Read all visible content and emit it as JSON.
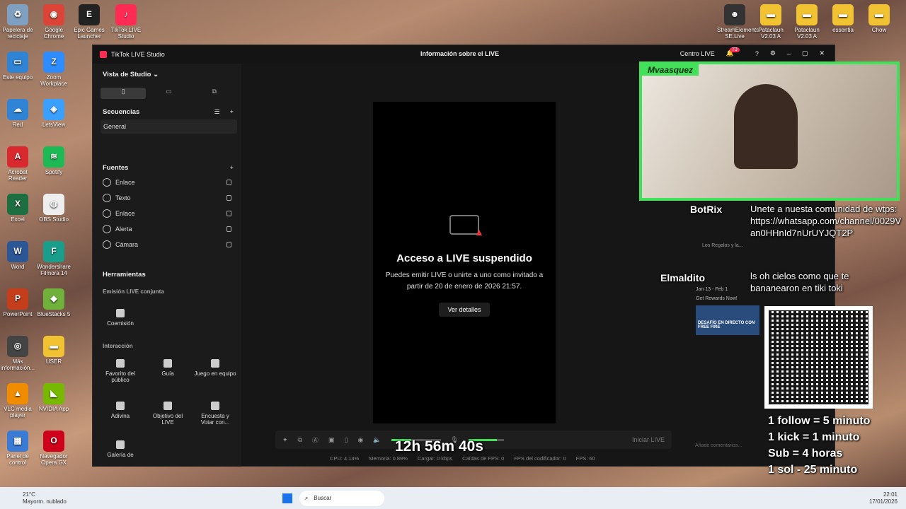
{
  "desktop": {
    "icons": [
      {
        "label": "Papelera de reciclaje",
        "color": "#7fa0c0",
        "glyph": "♻"
      },
      {
        "label": "Este equipo",
        "color": "#2f84d6",
        "glyph": "▭"
      },
      {
        "label": "Red",
        "color": "#2f84d6",
        "glyph": "☁"
      },
      {
        "label": "Acrobat Reader",
        "color": "#d8292f",
        "glyph": "A"
      },
      {
        "label": "Excel",
        "color": "#1d6f42",
        "glyph": "X"
      },
      {
        "label": "Word",
        "color": "#2b5797",
        "glyph": "W"
      },
      {
        "label": "PowerPoint",
        "color": "#c43e1c",
        "glyph": "P"
      },
      {
        "label": "Más información...",
        "color": "#444",
        "glyph": "◎"
      },
      {
        "label": "VLC media player",
        "color": "#f08c00",
        "glyph": "▲"
      },
      {
        "label": "Panel de control",
        "color": "#3a7bd5",
        "glyph": "▦"
      }
    ],
    "icons2": [
      {
        "label": "Google Chrome",
        "color": "#db4437",
        "glyph": "◉"
      },
      {
        "label": "Zoom Workplace",
        "color": "#2d8cff",
        "glyph": "Z"
      },
      {
        "label": "LetsView",
        "color": "#3aa0ff",
        "glyph": "◈"
      },
      {
        "label": "Spotify",
        "color": "#1db954",
        "glyph": "≋"
      },
      {
        "label": "OBS Studio",
        "color": "#eee",
        "glyph": "◍"
      },
      {
        "label": "Wondershare Filmora 14",
        "color": "#1a9e8c",
        "glyph": "F"
      },
      {
        "label": "BlueStacks 5",
        "color": "#6fb13a",
        "glyph": "◆"
      },
      {
        "label": "USER",
        "color": "#f1c232",
        "glyph": "▬"
      },
      {
        "label": "NVIDIA App",
        "color": "#76b900",
        "glyph": "◣"
      },
      {
        "label": "Navegador Opera GX",
        "color": "#d0021b",
        "glyph": "O"
      }
    ],
    "top_icons": [
      {
        "label": "Epic Games Launcher",
        "color": "#222",
        "glyph": "E"
      },
      {
        "label": "TikTok LIVE Studio",
        "color": "#fe2c55",
        "glyph": "♪"
      }
    ],
    "right_icons": [
      {
        "label": "StreamElements SE.Live",
        "color": "#333",
        "glyph": "☻"
      },
      {
        "label": "Pataclaun V2.03 A",
        "color": "#f1c232",
        "glyph": "▬"
      },
      {
        "label": "Pataclaun V2.03 A",
        "color": "#f1c232",
        "glyph": "▬"
      },
      {
        "label": "essentia",
        "color": "#f1c232",
        "glyph": "▬"
      },
      {
        "label": "Chow",
        "color": "#f1c232",
        "glyph": "▬"
      }
    ]
  },
  "window": {
    "title": "TikTok LIVE Studio",
    "center_title": "Información sobre el LIVE",
    "centro_live": "Centro LIVE",
    "notif_count": "73"
  },
  "sidebar": {
    "view_label": "Vista de Studio",
    "sequences_title": "Secuencias",
    "sequence_item": "General",
    "sources_title": "Fuentes",
    "sources": [
      "Enlace",
      "Texto",
      "Enlace",
      "Alerta",
      "Cámara"
    ],
    "tools_title": "Herramientas",
    "joint_title": "Emisión LIVE conjunta",
    "coemision": "Coemisión",
    "interaction_title": "Interacción",
    "tiles": [
      "Favorito del público",
      "Guía",
      "Juego en equipo",
      "Adivina",
      "Objetivo del LIVE",
      "Encuesta y Votar con...",
      "Galería de"
    ]
  },
  "stage": {
    "heading": "Acceso a LIVE suspendido",
    "body1": "Puedes emitir LIVE o unirte a uno como invitado a",
    "body2": "partir de 20 de enero de 2026 21:57.",
    "details_button": "Ver detalles"
  },
  "toolbar": {
    "start_live": "Iniciar LIVE",
    "timer": "12h 56m 40s"
  },
  "status": [
    "CPU: 4.14%",
    "Memoria: 0.89%",
    "Cargar: 0 kbps",
    "Caídas de FPS: 0",
    "FPS del codificador: 0",
    "FPS: 60"
  ],
  "overlay": {
    "cam_name": "Mvaasquez",
    "user1": "BotRix",
    "user1_msg": "Unete a nuesta comunidad de wtps: https://whatsapp.com/channel/0029Van0HHnId7nUrUYJQT2P",
    "user2": "Elmaldito",
    "user2_msg": "ls oh cielos como que te bananearon en tiki toki",
    "rules": [
      "1 follow = 5 minuto",
      "1 kick = 1 minuto",
      "Sub = 4 horas",
      "1 sol - 25 minuto"
    ],
    "right_panel_1": "Los Regalos y la...",
    "right_panel_2": "Jan 13 - Feb 1",
    "right_panel_3": "Get Rewards Now!",
    "promo": "DESAFÍO EN DIRECTO CON FREE FIRE",
    "comment_placeholder": "Añade comentarios..."
  },
  "taskbar": {
    "weather_temp": "21°C",
    "weather_desc": "Mayorm. nublado",
    "search": "Buscar",
    "time": "22:01",
    "date": "17/01/2026"
  },
  "colors": {
    "accent": "#fe2c55",
    "overlay_green": "#43e05a"
  }
}
